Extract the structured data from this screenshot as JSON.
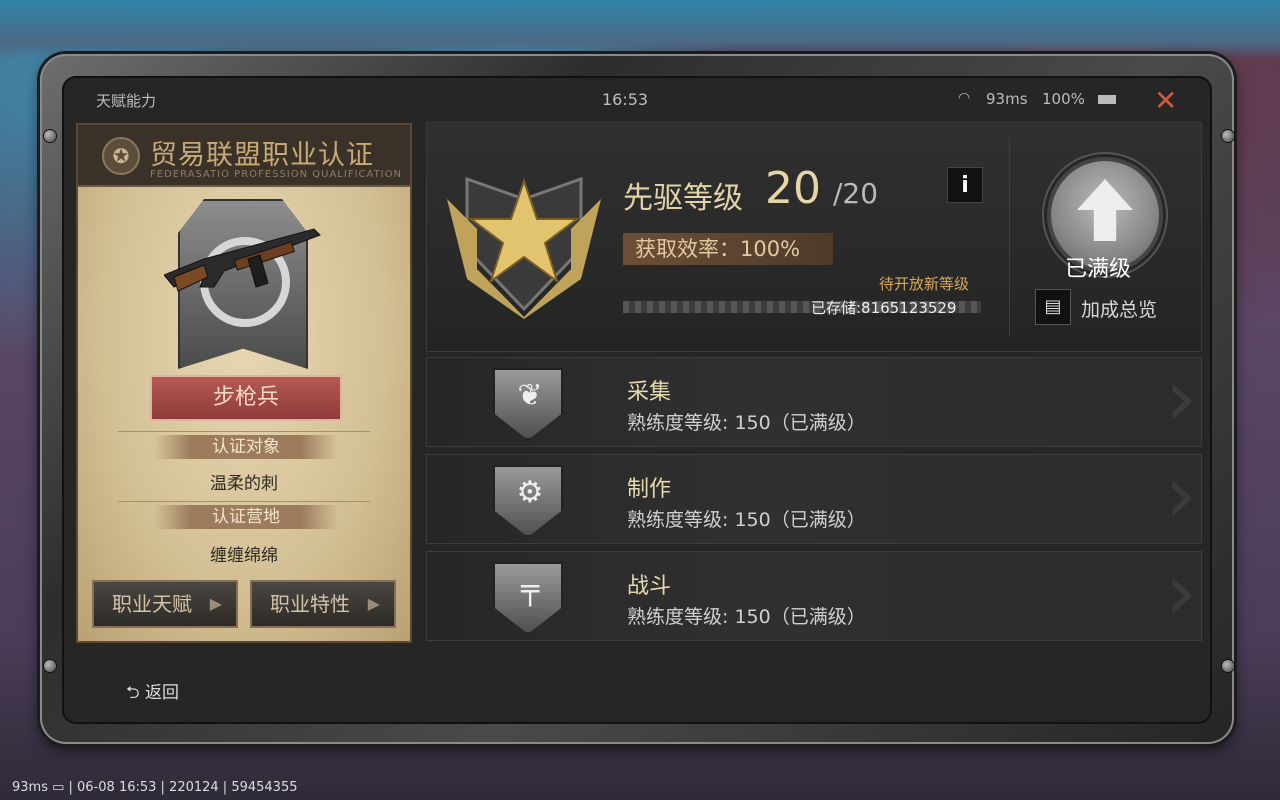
{
  "status_bar": {
    "title": "天赋能力",
    "time": "16:53",
    "ping": "93ms",
    "battery": "100%",
    "close_glyph": "✕"
  },
  "left_panel": {
    "header_title": "贸易联盟职业认证",
    "header_subtitle": "FEDERASATIO PROFESSION QUALIFICATION",
    "class_name": "步枪兵",
    "target_label": "认证对象",
    "target_value": "温柔的刺",
    "camp_label": "认证营地",
    "camp_value": "缠缠绵绵",
    "btn_talent": "职业天赋",
    "btn_trait": "职业特性"
  },
  "pioneer": {
    "label": "先驱等级",
    "level": "20",
    "max": "/20",
    "info_glyph": "i",
    "efficiency": "获取效率：100%",
    "pending": "待开放新等级",
    "stored": "已存储:8165123529",
    "maxed_label": "已满级",
    "overview_label": "加成总览"
  },
  "skills": [
    {
      "name": "采集",
      "proficiency": "熟练度等级: 150（已满级）",
      "icon": "leaf-icon"
    },
    {
      "name": "制作",
      "proficiency": "熟练度等级: 150（已满级）",
      "icon": "gear-hammer-icon"
    },
    {
      "name": "战斗",
      "proficiency": "熟练度等级: 150（已满级）",
      "icon": "smg-icon"
    }
  ],
  "back_label": "⮌ 返回",
  "bottom_info": {
    "text": "93ms ▭ | 06-08 16:53 | 220124 | 59454355"
  },
  "colors": {
    "accent_gold": "#e6d6a6",
    "close_red": "#d5573b",
    "class_red": "#b55a55"
  }
}
